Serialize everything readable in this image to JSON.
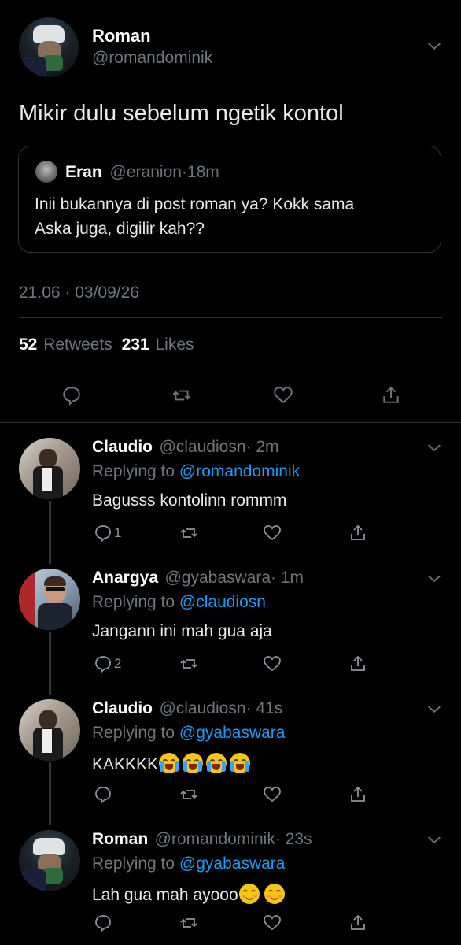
{
  "main_tweet": {
    "author_name": "Roman",
    "author_handle": "@romandominik",
    "text": "Mikir dulu sebelum ngetik kontol",
    "quote": {
      "author_name": "Eran",
      "author_handle": "@eranion",
      "sep": "·",
      "time": "18m",
      "line1": "Inii bukannya di post roman ya? Kokk sama",
      "line2": "Aska juga, digilir kah??"
    },
    "timestamp": "21.06 · 03/09/26",
    "retweets_count": "52",
    "retweets_label": "Retweets",
    "likes_count": "231",
    "likes_label": "Likes"
  },
  "replies": [
    {
      "name": "Claudio",
      "handle": "@claudiosn",
      "time": "· 2m",
      "replying_prefix": "Replying to",
      "replying_to": "@romandominik",
      "text": "Bagusss kontolinn rommm",
      "reply_count": "1"
    },
    {
      "name": "Anargya",
      "handle": "@gyabaswara",
      "time": "· 1m",
      "replying_prefix": "Replying to",
      "replying_to": "@claudiosn",
      "text": "Jangann ini mah gua aja",
      "reply_count": "2"
    },
    {
      "name": "Claudio",
      "handle": "@claudiosn",
      "time": "· 41s",
      "replying_prefix": "Replying to",
      "replying_to": "@gyabaswara",
      "text": "KAKKKK",
      "reply_count": ""
    },
    {
      "name": "Roman",
      "handle": "@romandominik",
      "time": "· 23s",
      "replying_prefix": "Replying to",
      "replying_to": "@gyabaswara",
      "text": "Lah gua mah ayooo",
      "reply_count": ""
    }
  ],
  "colors": {
    "background": "#000000",
    "muted": "#6e767d",
    "link": "#1d9bf0",
    "divider": "#2f3336"
  },
  "icons": [
    "chevron-down-icon",
    "reply-icon",
    "retweet-icon",
    "like-icon",
    "share-icon",
    "loudly-crying-face-emoji",
    "relieved-face-emoji"
  ]
}
